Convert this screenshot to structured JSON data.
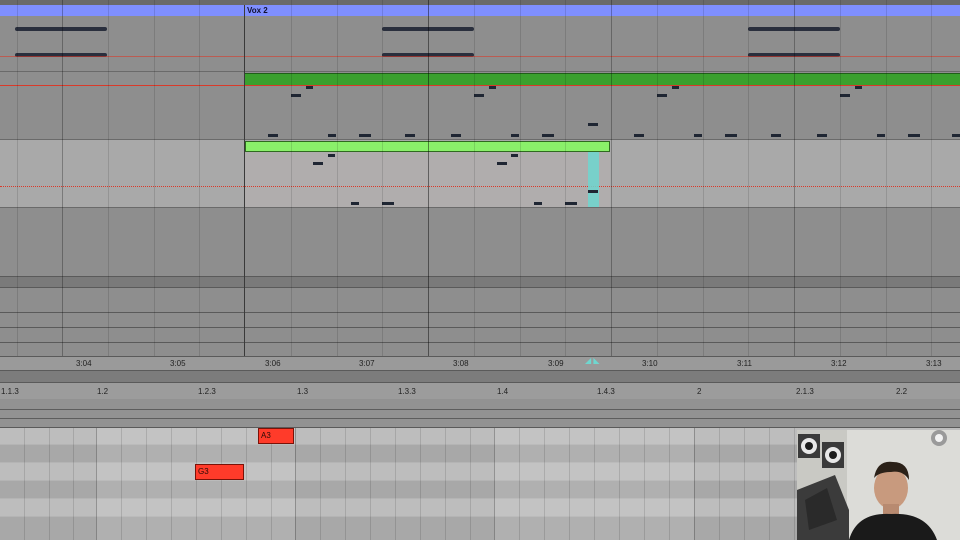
{
  "arrangement": {
    "clip_name": "Vox 2",
    "timeline_ticks": [
      "3:04",
      "3:05",
      "3:06",
      "3:07",
      "3:08",
      "3:09",
      "3:10",
      "3:11",
      "3:12",
      "3:13"
    ]
  },
  "piano_roll": {
    "beat_ticks": [
      "1.1.3",
      "1.2",
      "1.2.3",
      "1.3",
      "1.3.3",
      "1.4",
      "1.4.3",
      "2",
      "2.1.3",
      "2.2"
    ],
    "notes": [
      {
        "pitch": "A3",
        "label": "A3"
      },
      {
        "pitch": "G3",
        "label": "G3"
      }
    ]
  },
  "colors": {
    "clip_header": "#7f8fff",
    "green_clip": "#3aa02e",
    "light_green_clip": "#8af06a",
    "note_red": "#ff3b2a",
    "playhead_teal": "#6fd6cf",
    "automation_red": "#d93a2a"
  }
}
